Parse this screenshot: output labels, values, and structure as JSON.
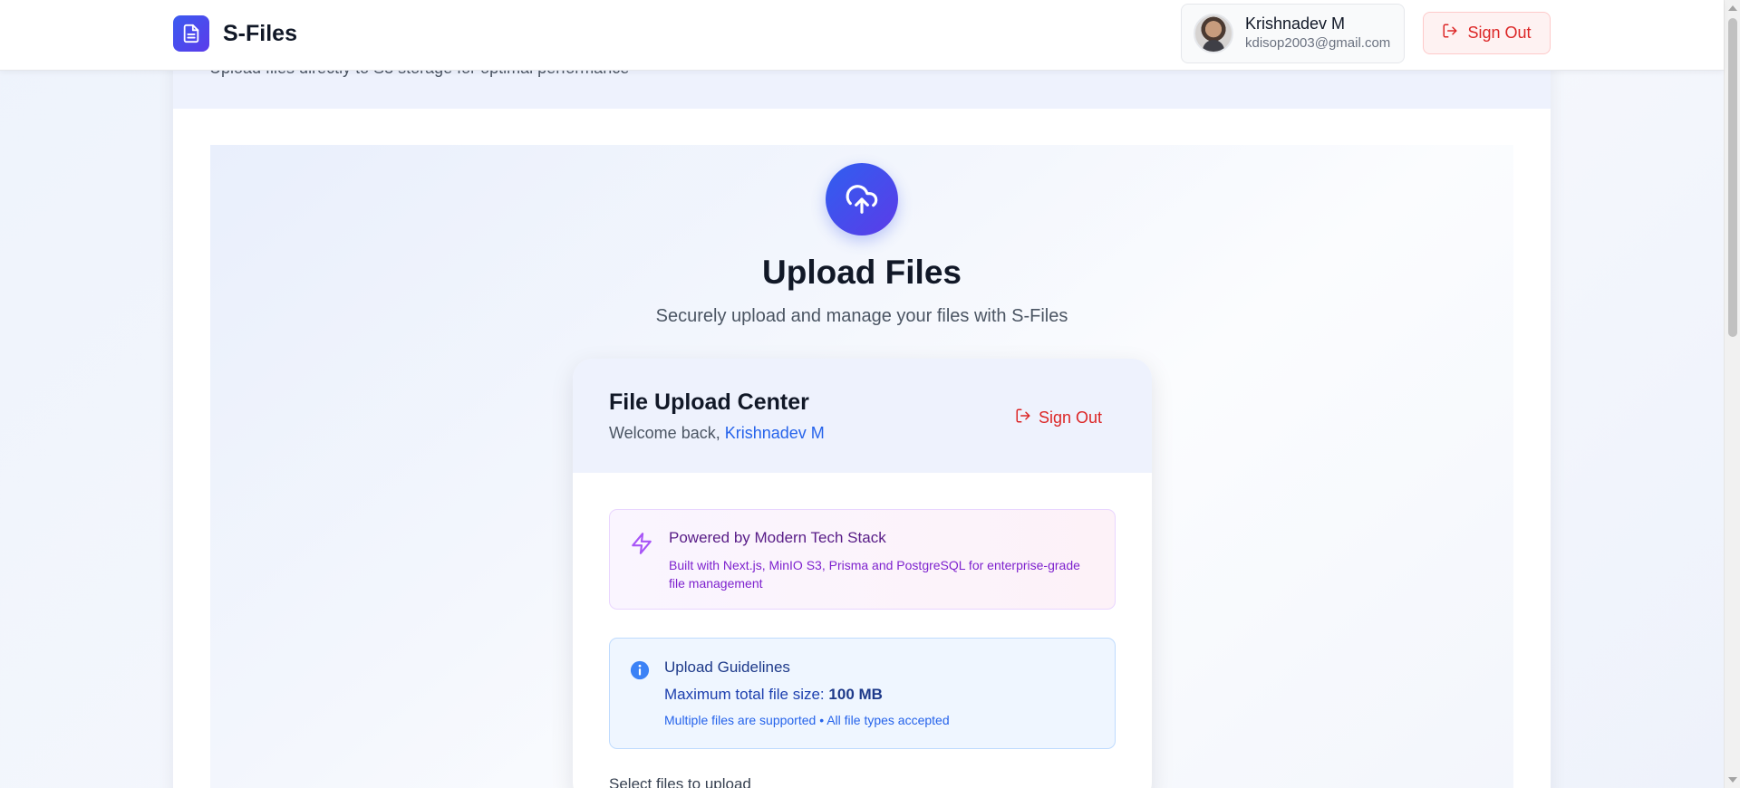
{
  "app": {
    "name": "S-Files",
    "subtitle": "Upload files directly to S3 storage for optimal performance"
  },
  "user": {
    "name": "Krishnadev M",
    "email": "kdisop2003@gmail.com"
  },
  "nav": {
    "sign_out_label": "Sign Out"
  },
  "hero": {
    "title": "Upload Files",
    "subtitle": "Securely upload and manage your files with S-Files"
  },
  "upload_card": {
    "title": "File Upload Center",
    "welcome_prefix": "Welcome back,",
    "welcome_name": "Krishnadev M",
    "sign_out_label": "Sign Out",
    "powered": {
      "title": "Powered by Modern Tech Stack",
      "description": "Built with Next.js, MinIO S3, Prisma and PostgreSQL for enterprise-grade file management"
    },
    "guidelines": {
      "title": "Upload Guidelines",
      "size_label": "Maximum total file size:",
      "size_value": "100 MB",
      "note": "Multiple files are supported • All file types accepted"
    },
    "select_label": "Select files to upload"
  },
  "colors": {
    "brand": "#3b5bf0",
    "danger": "#dc2626",
    "link": "#2563eb",
    "accent_purple": "#7e22ce"
  },
  "icons": {
    "brand": "file-document-icon",
    "sign_out": "log-out-icon",
    "hero": "cloud-upload-icon",
    "powered": "lightning-bolt-icon",
    "guidelines": "info-icon"
  }
}
